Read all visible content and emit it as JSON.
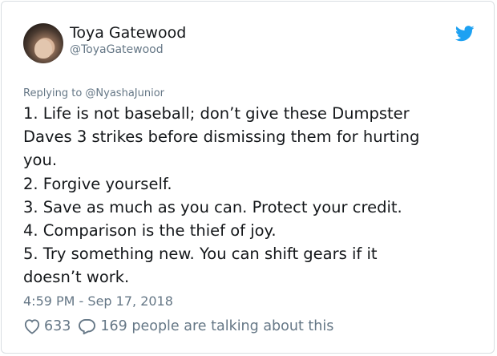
{
  "author": {
    "name": "Toya Gatewood",
    "handle": "@ToyaGatewood"
  },
  "reply_context": "Replying to @NyashaJunior",
  "tweet_lines": [
    "1. Life is not baseball; don’t give these Dumpster",
    "Daves 3 strikes before dismissing them for hurting",
    "you.",
    "2. Forgive yourself.",
    "3. Save as much as you can. Protect your credit.",
    "4. Comparison is the thief of joy.",
    "5. Try something new. You can shift gears if it",
    "doesn’t work."
  ],
  "timestamp": "4:59 PM - Sep 17, 2018",
  "likes": "633",
  "conversation": "169 people are talking about this",
  "colors": {
    "twitter_blue": "#1da1f2",
    "muted_text": "#657786",
    "main_text": "#14171a"
  },
  "icons": [
    "twitter-bird-icon",
    "heart-icon",
    "comment-icon"
  ]
}
